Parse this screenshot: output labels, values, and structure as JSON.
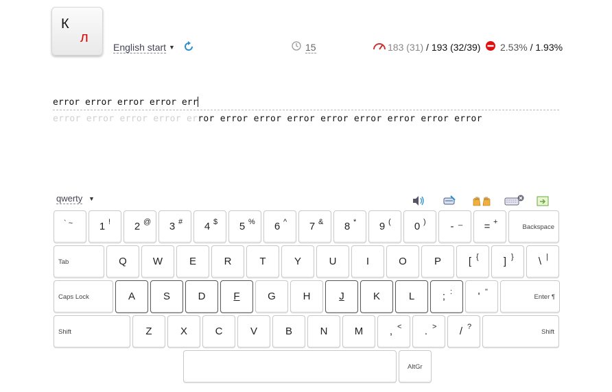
{
  "logo": {
    "letter1": "К",
    "letter2": "л"
  },
  "header": {
    "lesson": "English start",
    "timer": "15",
    "speed_current": "183 (31)",
    "speed_separator": "/",
    "speed_best": "193 (32/39)",
    "errors_current": "2.53%",
    "errors_separator": "/",
    "errors_best": "1.93%"
  },
  "exercise": {
    "typed": "error error error error err",
    "source_done": "error error error error er",
    "source_remaining": "ror error error error error error error error error"
  },
  "keyboard_layout": "qwerty",
  "keys": {
    "row1": [
      {
        "m": "",
        "s": "` ~"
      },
      {
        "m": "1",
        "s": "!"
      },
      {
        "m": "2",
        "s": "@"
      },
      {
        "m": "3",
        "s": "#"
      },
      {
        "m": "4",
        "s": "$"
      },
      {
        "m": "5",
        "s": "%"
      },
      {
        "m": "6",
        "s": "^"
      },
      {
        "m": "7",
        "s": "&"
      },
      {
        "m": "8",
        "s": "*"
      },
      {
        "m": "9",
        "s": "("
      },
      {
        "m": "0",
        "s": ")"
      },
      {
        "m": "-",
        "s": "_"
      },
      {
        "m": "=",
        "s": "+"
      },
      {
        "fn": "Backspace"
      }
    ],
    "row2": [
      {
        "fn": "Tab"
      },
      {
        "m": "Q"
      },
      {
        "m": "W"
      },
      {
        "m": "E"
      },
      {
        "m": "R"
      },
      {
        "m": "T"
      },
      {
        "m": "Y"
      },
      {
        "m": "U"
      },
      {
        "m": "I"
      },
      {
        "m": "O"
      },
      {
        "m": "P"
      },
      {
        "m": "[",
        "s": "{"
      },
      {
        "m": "]",
        "s": "}"
      },
      {
        "m": "\\",
        "s": "|"
      }
    ],
    "row3": [
      {
        "fn": "Caps Lock"
      },
      {
        "m": "A"
      },
      {
        "m": "S"
      },
      {
        "m": "D"
      },
      {
        "m": "F"
      },
      {
        "m": "G"
      },
      {
        "m": "H"
      },
      {
        "m": "J"
      },
      {
        "m": "K"
      },
      {
        "m": "L"
      },
      {
        "m": ";",
        "s": ":"
      },
      {
        "m": "'",
        "s": "\""
      },
      {
        "fn": "Enter ¶"
      }
    ],
    "row4": [
      {
        "fn": "Shift"
      },
      {
        "m": "Z"
      },
      {
        "m": "X"
      },
      {
        "m": "C"
      },
      {
        "m": "V"
      },
      {
        "m": "B"
      },
      {
        "m": "N"
      },
      {
        "m": "M"
      },
      {
        "m": ",",
        "s": "<"
      },
      {
        "m": ".",
        "s": ">"
      },
      {
        "m": "/",
        "s": "?"
      },
      {
        "fn": "Shift"
      }
    ],
    "row5": [
      {
        "fn": ""
      },
      {
        "fn": "AltGr"
      }
    ]
  },
  "icons": {
    "restart": "refresh-icon",
    "timer": "clock-icon",
    "speed": "speedometer-icon",
    "errors": "error-icon",
    "sound": "speaker-icon",
    "keyboard_color": "keyboard-color-icon",
    "hands": "hands-icon",
    "keyboard_hide": "keyboard-hide-icon",
    "fullscreen": "fullscreen-icon"
  }
}
